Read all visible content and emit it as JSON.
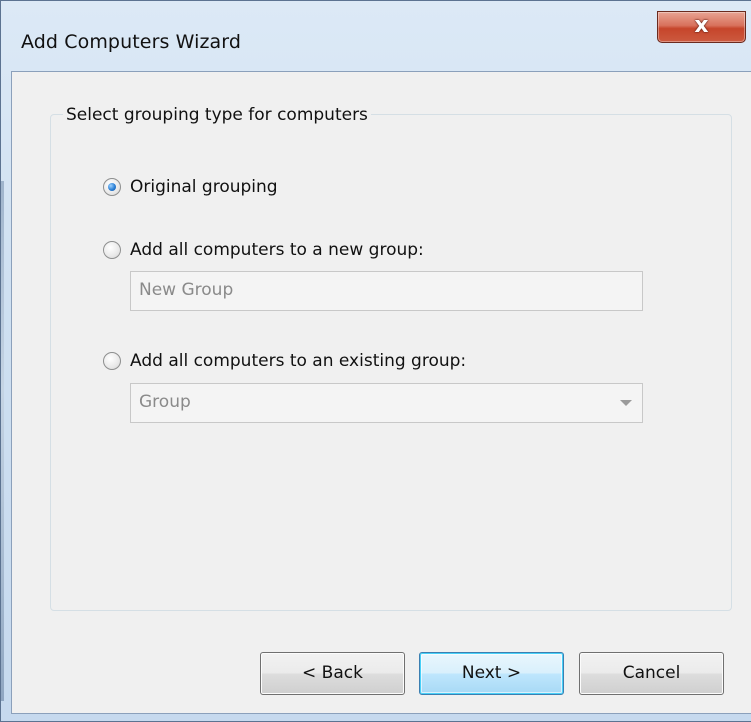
{
  "window": {
    "title": "Add Computers Wizard",
    "close_glyph": "x"
  },
  "group": {
    "legend": "Select grouping type for computers"
  },
  "options": [
    {
      "label": "Original grouping",
      "checked": true
    },
    {
      "label": "Add all computers to a new group:",
      "checked": false
    },
    {
      "label": "Add all computers to an existing group:",
      "checked": false
    }
  ],
  "new_group_field": {
    "value": "New Group"
  },
  "existing_group_combo": {
    "value": "Group"
  },
  "buttons": {
    "back": "< Back",
    "next": "Next >",
    "cancel": "Cancel"
  },
  "colors": {
    "accent": "#2a7fd6",
    "close_button": "#c6452b",
    "disabled_text": "#8a8a8a"
  }
}
